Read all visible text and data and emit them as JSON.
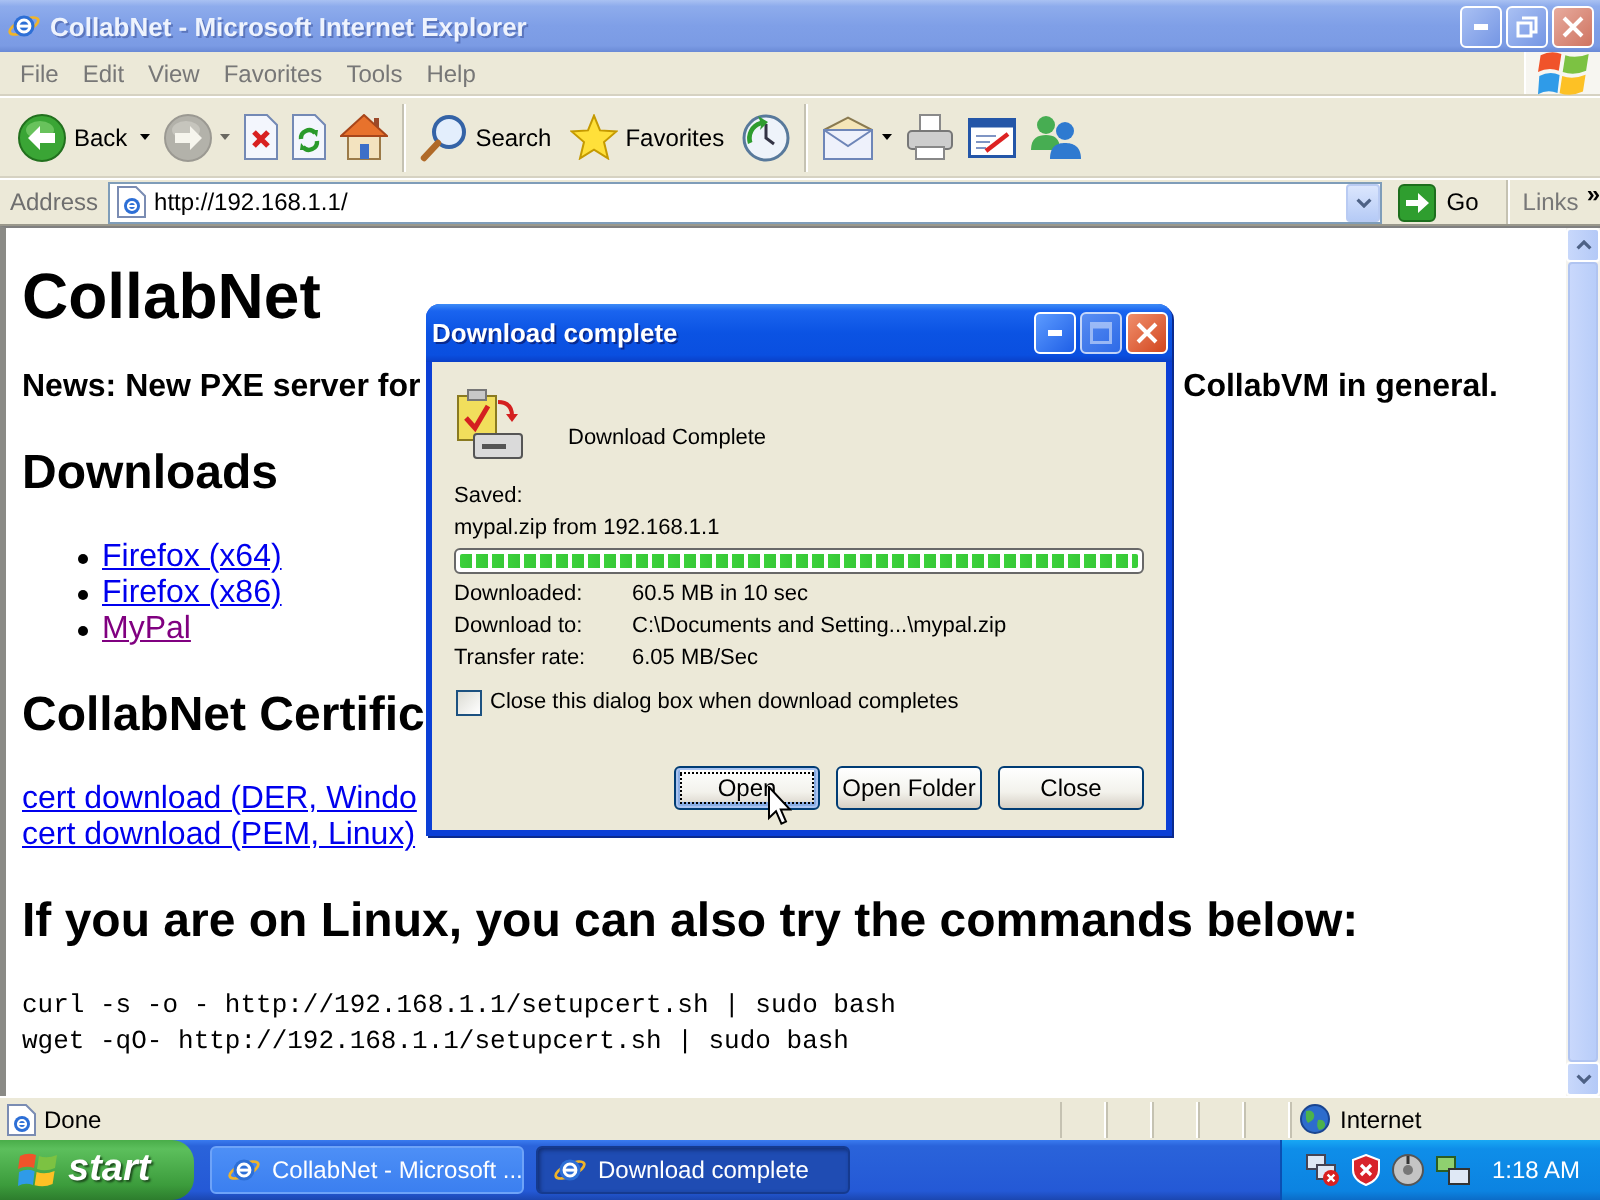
{
  "window": {
    "title": "CollabNet - Microsoft Internet Explorer"
  },
  "menu": [
    "File",
    "Edit",
    "View",
    "Favorites",
    "Tools",
    "Help"
  ],
  "toolbar": {
    "groups": [
      [
        {
          "kind": "back",
          "label": "Back",
          "dropdown": true,
          "disabled": false
        },
        {
          "kind": "forward",
          "dropdown": true,
          "disabled": true
        },
        {
          "kind": "stop",
          "disabled": false
        },
        {
          "kind": "refresh",
          "disabled": false
        },
        {
          "kind": "home",
          "disabled": false
        }
      ],
      [
        {
          "kind": "search",
          "label": "Search",
          "disabled": false
        },
        {
          "kind": "favorites",
          "label": "Favorites",
          "disabled": false
        },
        {
          "kind": "history",
          "disabled": false
        }
      ],
      [
        {
          "kind": "mail",
          "dropdown": true,
          "disabled": false
        },
        {
          "kind": "print",
          "disabled": false
        },
        {
          "kind": "edit",
          "disabled": false
        },
        {
          "kind": "messenger",
          "disabled": false
        }
      ]
    ]
  },
  "address_bar": {
    "label": "Address",
    "url": "http://192.168.1.1/",
    "go": "Go",
    "links": "Links",
    "more": "»"
  },
  "page": {
    "title": "CollabNet",
    "news": [
      "News: New PXE server for",
      "CollabVM in general."
    ],
    "sections": [
      {
        "kind": "bullets",
        "heading": "Downloads",
        "links": [
          {
            "text": "Firefox (x64)",
            "visited": false
          },
          {
            "text": "Firefox (x86)",
            "visited": false
          },
          {
            "text": "MyPal",
            "visited": true
          }
        ]
      },
      {
        "kind": "links",
        "heading": "CollabNet Certific",
        "links": [
          {
            "text": "cert download (DER, Windo",
            "visited": false
          },
          {
            "text": "cert download (PEM, Linux)",
            "visited": false
          }
        ]
      },
      {
        "kind": "code",
        "heading": "If you are on Linux, you can also try the commands below:",
        "lines": [
          "curl -s -o - http://192.168.1.1/setupcert.sh | sudo bash",
          "wget -qO- http://192.168.1.1/setupcert.sh | sudo bash"
        ]
      }
    ]
  },
  "dialog": {
    "title": "Download complete",
    "heading": "Download Complete",
    "saved_label": "Saved:",
    "saved_item": "mypal.zip from 192.168.1.1",
    "progress": {
      "level": 1
    },
    "details": [
      {
        "label": "Downloaded:",
        "value": "60.5 MB in 10 sec"
      },
      {
        "label": "Download to:",
        "value": "C:\\Documents and Setting...\\mypal.zip"
      },
      {
        "label": "Transfer rate:",
        "value": "6.05 MB/Sec"
      }
    ],
    "close_option": {
      "label": "Close this dialog box when download completes",
      "checked": false
    },
    "buttons": [
      {
        "label": "Open",
        "focused": true
      },
      {
        "label": "Open Folder",
        "focused": false
      },
      {
        "label": "Close",
        "focused": false
      }
    ]
  },
  "status_bar": {
    "text": "Done",
    "zone": "Internet"
  },
  "taskbar": {
    "start": "start",
    "tasks": [
      {
        "label": "CollabNet - Microsoft ...",
        "selected": false
      },
      {
        "label": "Download complete",
        "selected": true
      }
    ],
    "clock": "1:18 AM"
  }
}
